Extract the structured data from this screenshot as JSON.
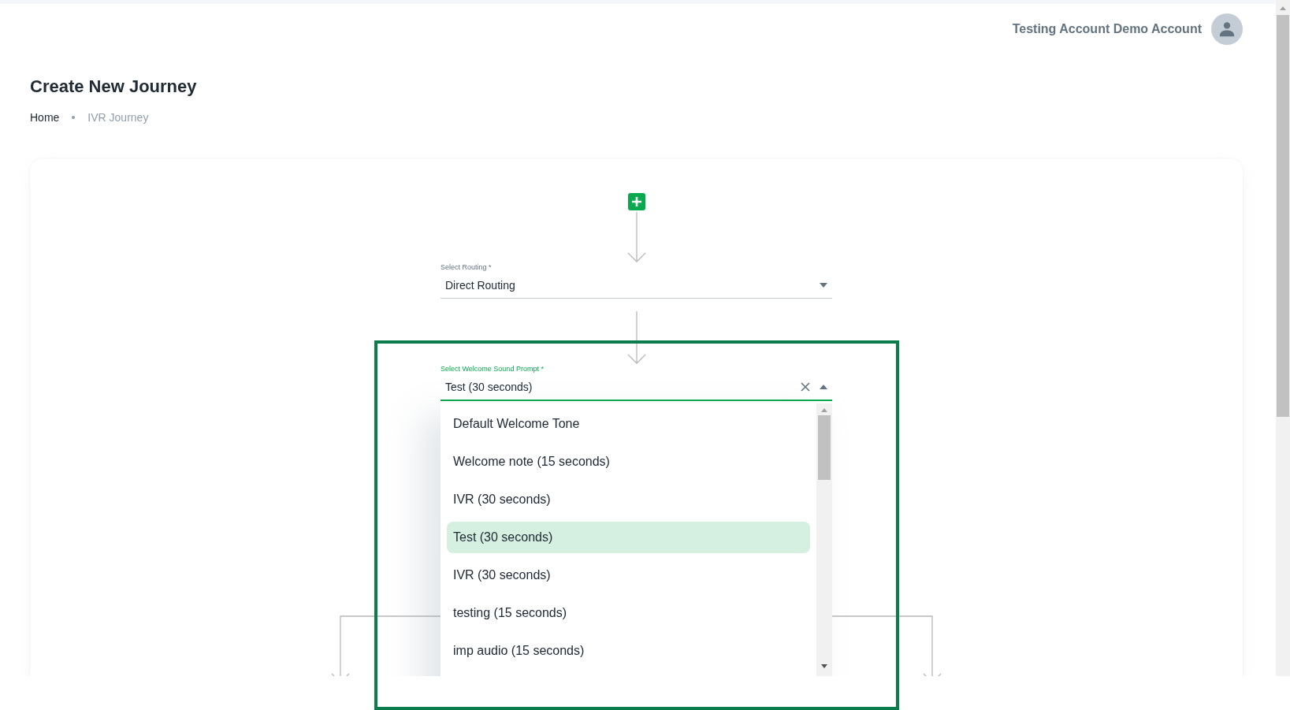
{
  "user": {
    "name": "Testing Account Demo Account"
  },
  "page": {
    "title": "Create New Journey",
    "breadcrumb": [
      {
        "label": "Home",
        "selected": false
      },
      {
        "label": "IVR Journey",
        "selected": true
      }
    ]
  },
  "flow": {
    "routing": {
      "label": "Select Routing *",
      "value": "Direct Routing",
      "expanded": false
    },
    "welcome_prompt": {
      "label": "Select Welcome Sound Prompt *",
      "value": "Test (30 seconds)",
      "expanded": true,
      "options": [
        {
          "label": "Default Welcome Tone",
          "selected": false
        },
        {
          "label": "Welcome note (15 seconds)",
          "selected": false
        },
        {
          "label": "IVR (30 seconds)",
          "selected": false
        },
        {
          "label": "Test (30 seconds)",
          "selected": true
        },
        {
          "label": "IVR (30 seconds)",
          "selected": false
        },
        {
          "label": "testing (15 seconds)",
          "selected": false
        },
        {
          "label": "imp audio (15 seconds)",
          "selected": false
        }
      ]
    }
  }
}
